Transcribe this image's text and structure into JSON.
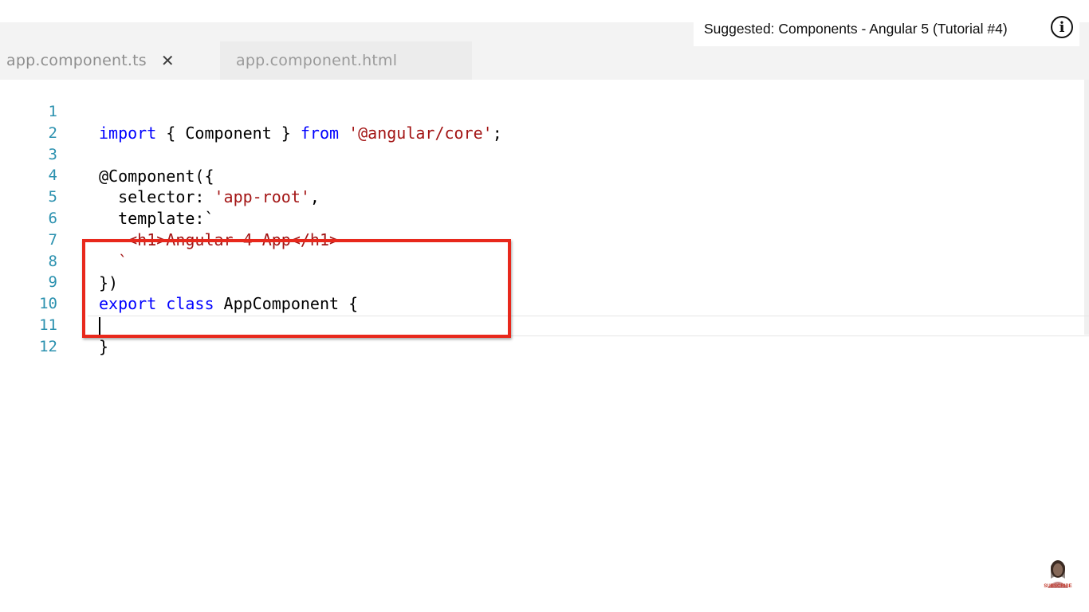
{
  "tabs": [
    {
      "label": "app.component.ts",
      "close_glyph": "✕"
    },
    {
      "label": "app.component.html"
    }
  ],
  "overlay": {
    "suggested_text": "Suggested: Components - Angular 5 (Tutorial #4)",
    "info_glyph": "i"
  },
  "editor": {
    "lines": [
      {
        "number": "1"
      },
      {
        "number": "2"
      },
      {
        "number": "3"
      },
      {
        "number": "4"
      },
      {
        "number": "5"
      },
      {
        "number": "6"
      },
      {
        "number": "7"
      },
      {
        "number": "8"
      },
      {
        "number": "9"
      },
      {
        "number": "10"
      },
      {
        "number": "11"
      },
      {
        "number": "12"
      }
    ],
    "code": {
      "l1_import": "import",
      "l1_mid": " { Component } ",
      "l1_from": "from",
      "l1_space": " ",
      "l1_str": "'@angular/core'",
      "l1_semi": ";",
      "l3": "@Component({",
      "l4_key": "  selector: ",
      "l4_str": "'app-root'",
      "l4_comma": ",",
      "l5": "  template:`",
      "l6_str": "   <h1>Angular 4 App</h1>",
      "l7": "  `",
      "l8": "})",
      "l9_export": "export",
      "l9_class": " class",
      "l9_rest": " AppComponent {",
      "l11": "}"
    }
  },
  "watermark": {
    "subscribe_label": "SUBSCRIBE"
  },
  "colors": {
    "keyword": "#0000ff",
    "string": "#a31515",
    "line_number": "#2b91af",
    "highlight": "#e8281c"
  }
}
